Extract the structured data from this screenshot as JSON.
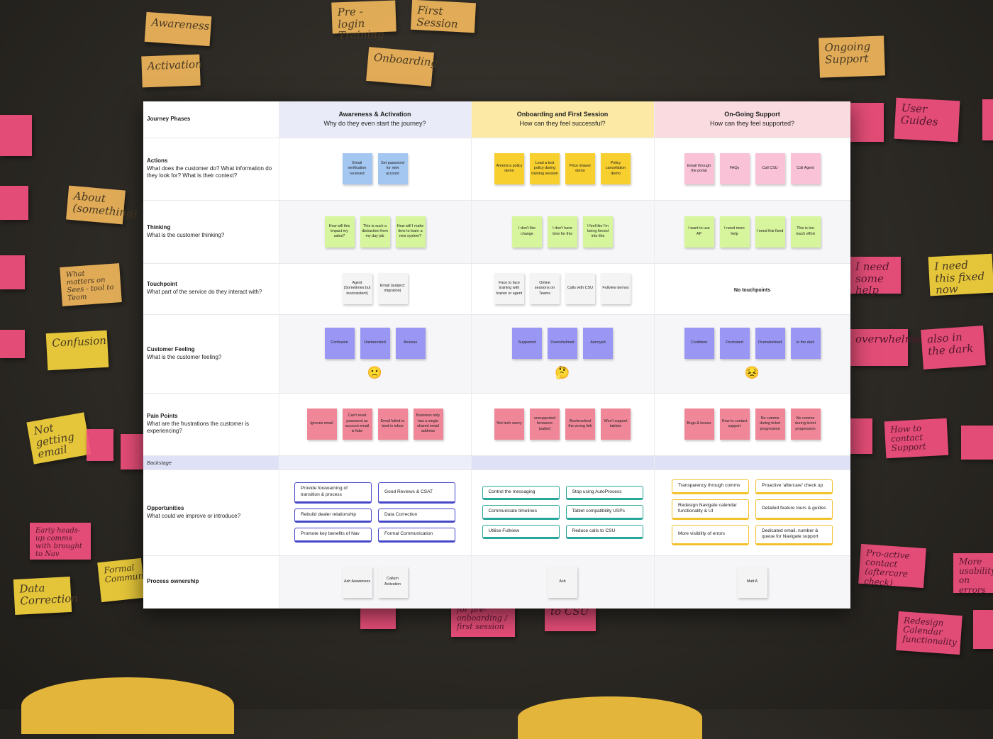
{
  "wall": {
    "awareness": "Awareness",
    "activation": "Activation",
    "pre_login": "Pre - login Training",
    "first_session": "First Session",
    "onboarding": "Onboarding",
    "ongoing": "Ongoing Support",
    "user_guides": "User Guides",
    "about": "About (something)",
    "what_matters": "What matters on Sees - tool to Team",
    "confusion": "Confusion",
    "not_getting_email": "Not getting email",
    "early_heads": "Early heads-up comms with brought to Nav",
    "data_correction": "Data Correction",
    "formal_comms": "Formal Communication",
    "need_help": "I need some help",
    "need_fixed": "I need this fixed now",
    "overwhelmed": "overwhelmed",
    "also_dark": "also in the dark",
    "how_contact": "How to contact Support",
    "pro_active": "Pro-active contact (aftercare check)",
    "more_usability": "More usability on errors",
    "redesign": "Redesign Calendar functionality",
    "to_csu": "to CSU",
    "pre_onboarding": "for pre-onboarding / first session"
  },
  "board": {
    "phases_label": "Journey Phases",
    "phases": [
      {
        "title": "Awareness & Activation",
        "subtitle": "Why do they even start the journey?"
      },
      {
        "title": "Onboarding and First Session",
        "subtitle": "How can they feel successful?"
      },
      {
        "title": "On-Going Support",
        "subtitle": "How can they feel supported?"
      }
    ],
    "actions": {
      "title": "Actions",
      "desc": "What does the customer do? What information do they look for? What is their context?",
      "c1": [
        "Email verification received",
        "Set password for new account"
      ],
      "c2": [
        "Amend a policy demo",
        "Load a test policy during training session",
        "Price drawer demo",
        "Policy cancellation demo"
      ],
      "c3": [
        "Email through the portal",
        "FAQs",
        "Call CSU",
        "Call Agent"
      ]
    },
    "thinking": {
      "title": "Thinking",
      "desc": "What is the customer thinking?",
      "c1": [
        "How will this impact my sales?",
        "This is such a distraction from my day job",
        "How will I make time to learn a new system?"
      ],
      "c2": [
        "I don't like change",
        "I don't have time for this",
        "I feel like I'm being forced into this"
      ],
      "c3": [
        "I want to use AP",
        "I need more help",
        "I need this fixed",
        "This is too much effort"
      ]
    },
    "touchpoint": {
      "title": "Touchpoint",
      "desc": "What part of the service do they interact with?",
      "c1": [
        "Agent (Sometimes but inconsistent)",
        "Email (subject: migration)"
      ],
      "c2": [
        "Face to face training with trainer or agent",
        "Online sessions on Teams",
        "Calls with CSU",
        "Fullview demos"
      ],
      "c3": "No touchpoints"
    },
    "feeling": {
      "title": "Customer Feeling",
      "desc": "What is the customer feeling?",
      "c1": [
        "Confusion",
        "Uninterested",
        "Anxious"
      ],
      "c1_emoji": "🙁",
      "c2": [
        "Supported",
        "Overwhelmed",
        "Annoyed"
      ],
      "c2_emoji": "🤔",
      "c3": [
        "Confident",
        "Frustrated",
        "Overwhelmed",
        "In the dark"
      ],
      "c3_emoji": "😣"
    },
    "pain": {
      "title": "Pain Points",
      "desc": "What are the frustrations the customer is experiencing?",
      "c1": [
        "Ignores email",
        "Can't reset password as account email is fake",
        "Email failed to land in inbox",
        "Business only has a single shared email address"
      ],
      "c2": [
        "Not tech savvy",
        "unsupported browsers (safari)",
        "Bookmarked the wrong link",
        "Won't support tablets"
      ],
      "c3": [
        "Bugs & issues",
        "How to contact support",
        "No comms during ticket progression",
        "No comms during ticket progression"
      ]
    },
    "backstage": "Backstage",
    "opportunities": {
      "title": "Opportunities",
      "desc": "What could we improve or introduce?",
      "c1": [
        "Provide forewarning of transition & process",
        "Good Reviews & CSAT",
        "Rebuild dealer relationship",
        "Data Correction",
        "Promote key benefits of Nav",
        "Formal Communication"
      ],
      "c2": [
        "Control the messaging",
        "Stop using AutoProcess",
        "Communicate timelines",
        "Tablet compatibility USPs",
        "Utilise Fullview",
        "Reduce calls to CSU"
      ],
      "c3": [
        "Transparency through comms",
        "Proactive 'aftercare' check up",
        "Redesign Navigate calendar functionality & UI",
        "Detailed feature tours & guides",
        "More visibility of errors",
        "Dedicated email, number & queue for Navigate support"
      ]
    },
    "ownership": {
      "title": "Process ownership",
      "c1": [
        "Ash Awareness",
        "Callum Activation"
      ],
      "c2": [
        "Ash"
      ],
      "c3": [
        "Matt A"
      ]
    }
  }
}
